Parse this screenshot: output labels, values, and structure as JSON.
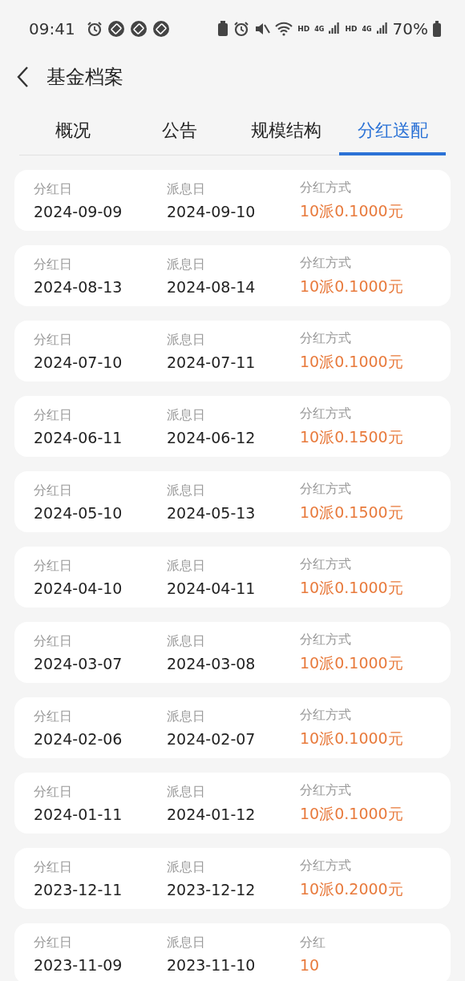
{
  "status_bar": {
    "time": "09:41",
    "network_labels": [
      "HD",
      "4G",
      "HD",
      "4G"
    ],
    "battery": "70%"
  },
  "header": {
    "title": "基金档案"
  },
  "tabs": [
    {
      "label": "概况",
      "selected": false
    },
    {
      "label": "公告",
      "selected": false
    },
    {
      "label": "规模结构",
      "selected": false
    },
    {
      "label": "分红送配",
      "selected": true
    }
  ],
  "records": [
    {
      "fields": [
        {
          "label": "分红日",
          "value": "2024-09-09"
        },
        {
          "label": "派息日",
          "value": "2024-09-10"
        },
        {
          "label": "分红方式",
          "value": "10派0.1000元",
          "kind": "amount"
        }
      ]
    },
    {
      "fields": [
        {
          "label": "分红日",
          "value": "2024-08-13"
        },
        {
          "label": "派息日",
          "value": "2024-08-14"
        },
        {
          "label": "分红方式",
          "value": "10派0.1000元",
          "kind": "amount"
        }
      ]
    },
    {
      "fields": [
        {
          "label": "分红日",
          "value": "2024-07-10"
        },
        {
          "label": "派息日",
          "value": "2024-07-11"
        },
        {
          "label": "分红方式",
          "value": "10派0.1000元",
          "kind": "amount"
        }
      ]
    },
    {
      "fields": [
        {
          "label": "分红日",
          "value": "2024-06-11"
        },
        {
          "label": "派息日",
          "value": "2024-06-12"
        },
        {
          "label": "分红方式",
          "value": "10派0.1500元",
          "kind": "amount"
        }
      ]
    },
    {
      "fields": [
        {
          "label": "分红日",
          "value": "2024-05-10"
        },
        {
          "label": "派息日",
          "value": "2024-05-13"
        },
        {
          "label": "分红方式",
          "value": "10派0.1500元",
          "kind": "amount"
        }
      ]
    },
    {
      "fields": [
        {
          "label": "分红日",
          "value": "2024-04-10"
        },
        {
          "label": "派息日",
          "value": "2024-04-11"
        },
        {
          "label": "分红方式",
          "value": "10派0.1000元",
          "kind": "amount"
        }
      ]
    },
    {
      "fields": [
        {
          "label": "分红日",
          "value": "2024-03-07"
        },
        {
          "label": "派息日",
          "value": "2024-03-08"
        },
        {
          "label": "分红方式",
          "value": "10派0.1000元",
          "kind": "amount"
        }
      ]
    },
    {
      "fields": [
        {
          "label": "分红日",
          "value": "2024-02-06"
        },
        {
          "label": "派息日",
          "value": "2024-02-07"
        },
        {
          "label": "分红方式",
          "value": "10派0.1000元",
          "kind": "amount"
        }
      ]
    },
    {
      "fields": [
        {
          "label": "分红日",
          "value": "2024-01-11"
        },
        {
          "label": "派息日",
          "value": "2024-01-12"
        },
        {
          "label": "分红方式",
          "value": "10派0.1000元",
          "kind": "amount"
        }
      ]
    },
    {
      "fields": [
        {
          "label": "分红日",
          "value": "2023-12-11"
        },
        {
          "label": "派息日",
          "value": "2023-12-12"
        },
        {
          "label": "分红方式",
          "value": "10派0.2000元",
          "kind": "amount"
        }
      ]
    },
    {
      "fields": [
        {
          "label": "分红日",
          "value": "2023-11-09"
        },
        {
          "label": "派息日",
          "value": "2023-11-10"
        },
        {
          "label": "分红",
          "value": "10",
          "kind": "amount"
        }
      ]
    }
  ]
}
